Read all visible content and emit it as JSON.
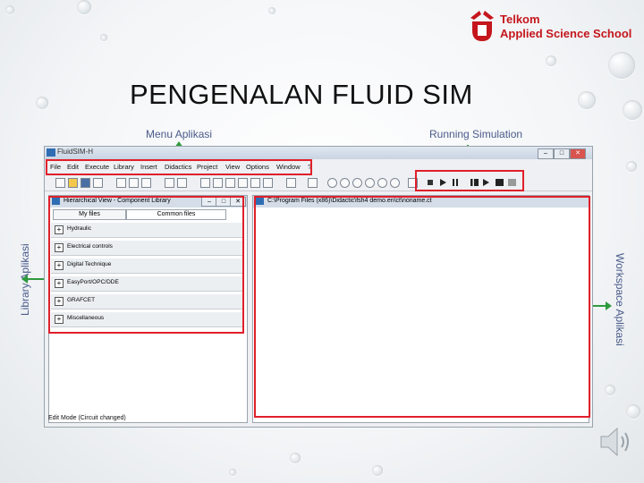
{
  "slide": {
    "title": "PENGENALAN FLUID SIM",
    "logo": {
      "line1": "Telkom",
      "line2": "Applied Science School",
      "brand_color": "#c4161c"
    }
  },
  "callouts": {
    "menu": "Menu Aplikasi",
    "running": "Running Simulation",
    "library": "Library Aplikasi",
    "workspace": "Workspace Aplikasi",
    "arrow_color": "#2e9a3e",
    "highlight_color": "#e0202a"
  },
  "app": {
    "title": "FluidSIM-H",
    "menu": [
      "File",
      "Edit",
      "Execute",
      "Library",
      "Insert",
      "Didactics",
      "Project",
      "View",
      "Options",
      "Window",
      "?"
    ],
    "library_panel": {
      "title": "Hierarchical View - Component Library",
      "tabs": [
        "My files",
        "Common files"
      ],
      "categories": [
        "Hydraulic",
        "Electrical controls",
        "Digital Technique",
        "EasyPort/OPC/DDE",
        "GRAFCET",
        "Miscellaneous"
      ]
    },
    "workspace": {
      "title": "C:\\Program Files (x86)\\Didactic\\fsh4 demo.en\\ct\\noname.ct"
    },
    "status": "Edit Mode (Circuit changed)"
  }
}
